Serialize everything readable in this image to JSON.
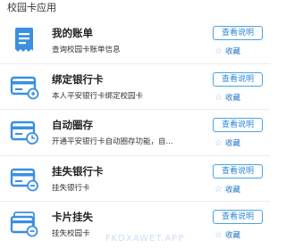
{
  "section_title": "校园卡应用",
  "items": [
    {
      "title": "我的账单",
      "desc": "查询校园卡账单信息",
      "button": "查看说明",
      "fav": "收藏",
      "icon": "bill-icon"
    },
    {
      "title": "绑定银行卡",
      "desc": "本人平安银行卡绑定校园卡",
      "button": "查看说明",
      "fav": "收藏",
      "icon": "bind-bank-card-icon"
    },
    {
      "title": "自动圈存",
      "desc": "开通平安银行卡自动圈存功能，自...",
      "button": "查看说明",
      "fav": "收藏",
      "icon": "auto-transfer-icon"
    },
    {
      "title": "挂失银行卡",
      "desc": "挂失银行卡",
      "button": "查看说明",
      "fav": "收藏",
      "icon": "report-lost-bank-card-icon"
    },
    {
      "title": "卡片挂失",
      "desc": "挂失校园卡",
      "button": "查看说明",
      "fav": "收藏",
      "icon": "report-lost-campus-card-icon"
    }
  ],
  "watermark": "FKDXAWET.APP",
  "colors": {
    "accent": "#2f86d8",
    "icon_blue": "#3b8fe0"
  }
}
